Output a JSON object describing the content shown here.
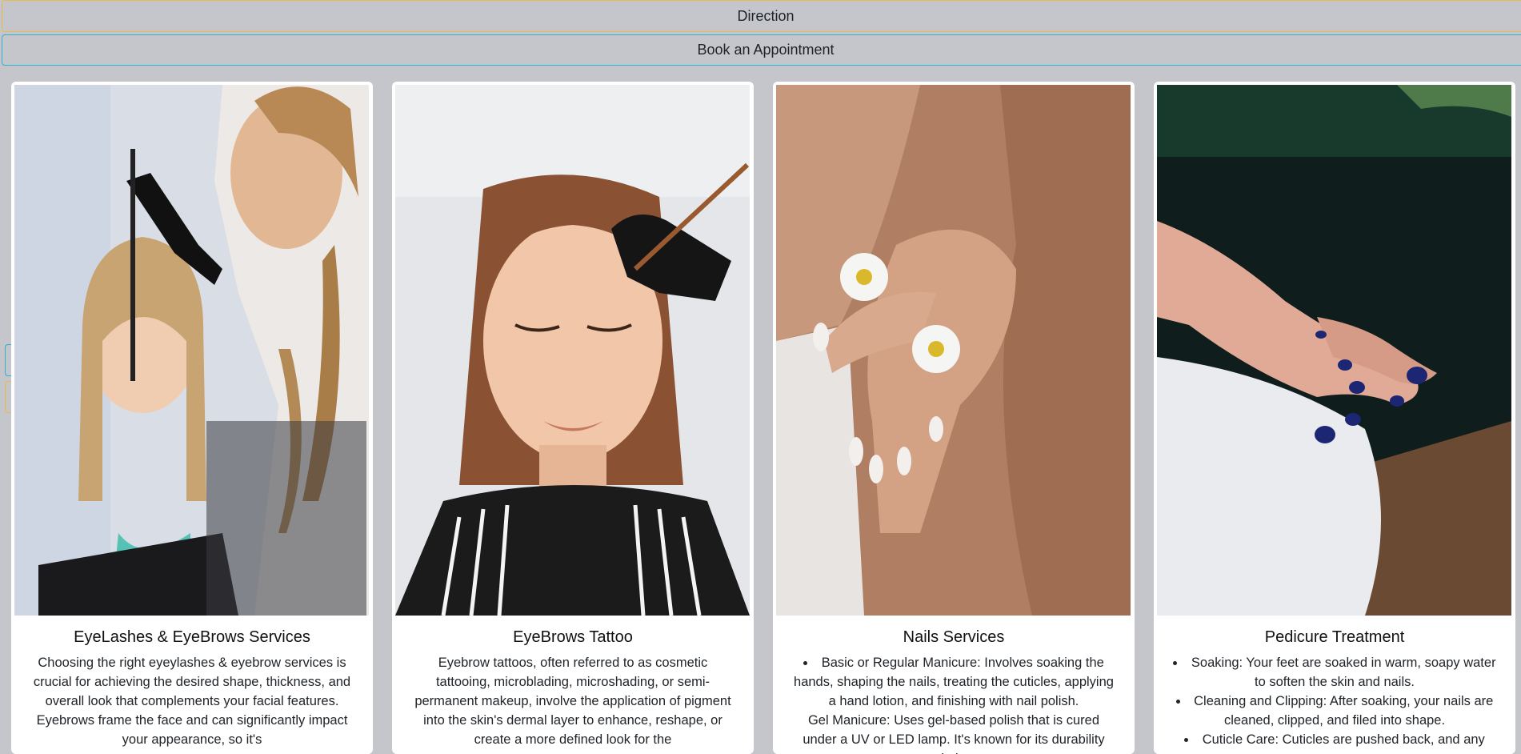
{
  "header": {
    "direction_label": "Direction",
    "book_label": "Book an Appointment"
  },
  "cards": [
    {
      "title": "EyeLashes & EyeBrows Services",
      "text": "Choosing the right eyeylashes & eyebrow services is crucial for achieving the desired shape, thickness, and overall look that complements your facial features. Eyebrows frame the face and can significantly impact your appearance, so it's",
      "image": "eyebrow-stylist-photo"
    },
    {
      "title": "EyeBrows Tattoo",
      "text": "Eyebrow tattoos, often referred to as cosmetic tattooing, microblading, microshading, or semi-permanent makeup, involve the application of pigment into the skin's dermal layer to enhance, reshape, or create a more defined look for the",
      "image": "eyebrow-tattoo-photo"
    },
    {
      "title": "Nails Services",
      "items": [
        "Basic or Regular Manicure: Involves soaking the hands, shaping the nails, treating the cuticles, applying a hand lotion, and finishing with nail polish."
      ],
      "extra": "Gel Manicure: Uses gel-based polish that is cured under a UV or LED lamp. It's known for its durability and glossy",
      "image": "manicure-daisy-photo"
    },
    {
      "title": "Pedicure Treatment",
      "items": [
        "Soaking: Your feet are soaked in warm, soapy water to soften the skin and nails.",
        "Cleaning and Clipping: After soaking, your nails are cleaned, clipped, and filed into shape.",
        "Cuticle Care: Cuticles are pushed back, and any"
      ],
      "image": "pedicure-photo"
    }
  ],
  "colors": {
    "page_bg": "#c4c6cb",
    "direction_border": "#e9b949",
    "book_border": "#2fb0cf",
    "card_bg": "#ffffff"
  }
}
